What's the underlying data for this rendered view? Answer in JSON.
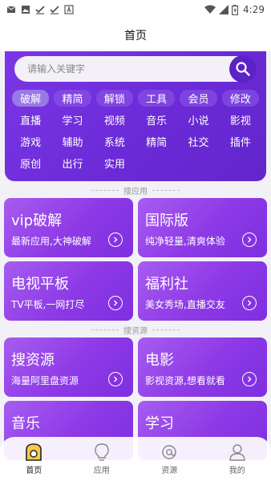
{
  "status_bar": {
    "left_icons": [
      "mail-notification-icon",
      "image-notification-icon",
      "check-notification-icon",
      "check-notification-icon",
      "font-notification-icon"
    ],
    "time": "4:29"
  },
  "header": {
    "title": "首页"
  },
  "search": {
    "placeholder": "请输入关键字"
  },
  "categories": [
    {
      "label": "破解",
      "selected": true
    },
    {
      "label": "精简"
    },
    {
      "label": "解锁"
    },
    {
      "label": "工具"
    },
    {
      "label": "会员"
    },
    {
      "label": "修改"
    },
    {
      "label": "直播"
    },
    {
      "label": "学习"
    },
    {
      "label": "视频"
    },
    {
      "label": "音乐"
    },
    {
      "label": "小说"
    },
    {
      "label": "影视"
    },
    {
      "label": "游戏"
    },
    {
      "label": "辅助"
    },
    {
      "label": "系统"
    },
    {
      "label": "精简"
    },
    {
      "label": "社交"
    },
    {
      "label": "插件"
    },
    {
      "label": "原创"
    },
    {
      "label": "出行"
    },
    {
      "label": "实用"
    }
  ],
  "sections": {
    "apps": "搜应用",
    "resources": "搜资源"
  },
  "cards": [
    {
      "title": "vip破解",
      "subtitle": "最新应用,大神破解"
    },
    {
      "title": "国际版",
      "subtitle": "纯净轻量,清爽体验"
    },
    {
      "title": "电视平板",
      "subtitle": "TV平板,一网打尽"
    },
    {
      "title": "福利社",
      "subtitle": "美女秀场,直播交友"
    },
    {
      "title": "搜资源",
      "subtitle": "海量阿里盘资源"
    },
    {
      "title": "电影",
      "subtitle": "影视资源,想看就看"
    },
    {
      "title": "音乐",
      "subtitle": ""
    },
    {
      "title": "学习",
      "subtitle": ""
    }
  ],
  "bottom_nav": [
    {
      "label": "首页",
      "icon": "home-icon",
      "active": true
    },
    {
      "label": "应用",
      "icon": "lightbulb-icon"
    },
    {
      "label": "资源",
      "icon": "at-sign-icon"
    },
    {
      "label": "我的",
      "icon": "user-icon"
    }
  ],
  "colors": {
    "primary": "#6a2ad6",
    "card": "#8d39e6",
    "background": "#f2f1f6"
  }
}
